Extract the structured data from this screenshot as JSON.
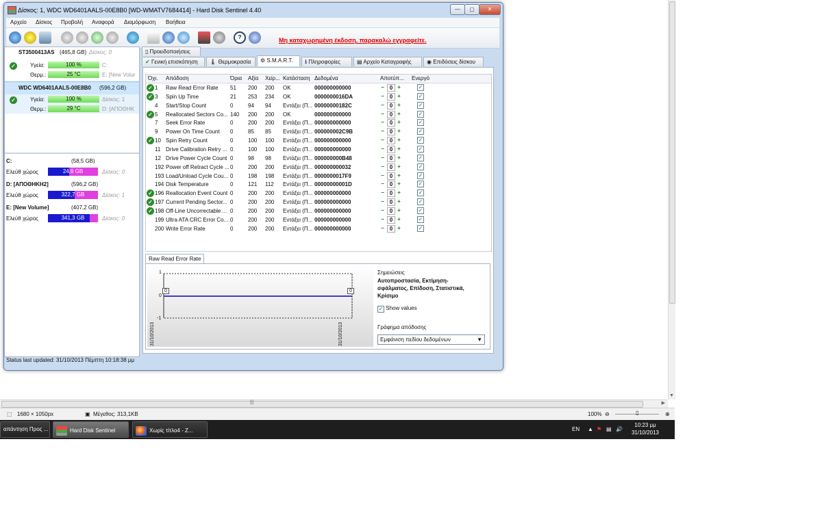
{
  "window": {
    "title": "Δίσκος: 1, WDC WD6401AALS-00E8B0 [WD-WMATV7684414]  -  Hard Disk Sentinel 4.40",
    "controls": [
      "—",
      "▢",
      "✕"
    ]
  },
  "menu": [
    "Αρχείο",
    "Δίσκος",
    "Προβολή",
    "Αναφορά",
    "Διαμόρφωση",
    "Βοήθεια"
  ],
  "toolbar": {
    "register_text": "Μη καταχωρημένη έκδοση, παρακαλώ εγγραφείτε."
  },
  "disks": [
    {
      "name": "ST3500413AS",
      "size": "(465,8 GB)",
      "disk_label": "Δίσκος: 0",
      "health_label": "Υγεία:",
      "health_value": "100 %",
      "health_pct": 100,
      "health_extra": "C:",
      "temp_label": "Θερμ.:",
      "temp_value": "25 °C",
      "temp_extra": "E: [New Volur"
    },
    {
      "name": "WDC WD6401AALS-00E8B0",
      "size": "(596,2 GB)",
      "disk_label": "",
      "health_label": "Υγεία:",
      "health_value": "100 %",
      "health_pct": 100,
      "health_extra": "Δίσκος: 1",
      "temp_label": "Θερμ.:",
      "temp_value": "29 °C",
      "temp_extra": "D: [ΑΠΟΘΗΚ"
    }
  ],
  "volumes": [
    {
      "name": "C:",
      "size": "(58,5 GB)",
      "free_label": "Ελεύθ χώρος",
      "free": "24,6 GB",
      "free_pct": 42,
      "disk": "Δίσκος: 0"
    },
    {
      "name": "D: [ΑΠΟΘΗΚΗ2]",
      "size": "(596,2 GB)",
      "free_label": "Ελεύθ χώρος",
      "free": "322,7 GB",
      "free_pct": 54,
      "disk": "Δίσκος: 1"
    },
    {
      "name": "E: [New Volume]",
      "size": "(407,2 GB)",
      "free_label": "Ελεύθ χώρος",
      "free": "341,3 GB",
      "free_pct": 84,
      "disk": "Δίσκος: 0"
    }
  ],
  "tabs_top": [
    "Προειδοποιήσεις"
  ],
  "tabs": [
    "Γενική επισκόπηση",
    "Θερμοκρασία",
    "S.M.A.R.T.",
    "Πληροφορίες",
    "Αρχείο Καταγραφής",
    "Επιδόσεις δίσκου"
  ],
  "selected_tab": "S.M.A.R.T.",
  "smart": {
    "headers": [
      "Όχι.",
      "Απόδοση",
      "Όρια",
      "Αξία",
      "Χείρ...",
      "Κατάσταση",
      "Δεδομένα",
      "Αποτύπ...",
      "Ενεργό"
    ],
    "rows": [
      {
        "ok": true,
        "id": "1",
        "name": "Raw Read Error Rate",
        "thr": "51",
        "val": "200",
        "worst": "200",
        "status": "OK",
        "data": "000000000000",
        "offset": "0"
      },
      {
        "ok": true,
        "id": "3",
        "name": "Spin Up Time",
        "thr": "21",
        "val": "253",
        "worst": "234",
        "status": "OK",
        "data": "0000000016DA",
        "offset": "0"
      },
      {
        "ok": false,
        "id": "4",
        "name": "Start/Stop Count",
        "thr": "0",
        "val": "94",
        "worst": "94",
        "status": "Εντάξει (Π...",
        "data": "00000000182C",
        "offset": "0"
      },
      {
        "ok": true,
        "id": "5",
        "name": "Reallocated Sectors Co...",
        "thr": "140",
        "val": "200",
        "worst": "200",
        "status": "OK",
        "data": "000000000000",
        "offset": "0"
      },
      {
        "ok": false,
        "id": "7",
        "name": "Seek Error Rate",
        "thr": "0",
        "val": "200",
        "worst": "200",
        "status": "Εντάξει (Π...",
        "data": "000000000000",
        "offset": "0"
      },
      {
        "ok": false,
        "id": "9",
        "name": "Power On Time Count",
        "thr": "0",
        "val": "85",
        "worst": "85",
        "status": "Εντάξει (Π...",
        "data": "000000002C9B",
        "offset": "0"
      },
      {
        "ok": true,
        "id": "10",
        "name": "Spin Retry Count",
        "thr": "0",
        "val": "100",
        "worst": "100",
        "status": "Εντάξει (Π...",
        "data": "000000000000",
        "offset": "0"
      },
      {
        "ok": false,
        "id": "11",
        "name": "Drive Calibration Retry ...",
        "thr": "0",
        "val": "100",
        "worst": "100",
        "status": "Εντάξει (Π...",
        "data": "000000000000",
        "offset": "0"
      },
      {
        "ok": false,
        "id": "12",
        "name": "Drive Power Cycle Count",
        "thr": "0",
        "val": "98",
        "worst": "98",
        "status": "Εντάξει (Π...",
        "data": "000000000B48",
        "offset": "0"
      },
      {
        "ok": false,
        "id": "192",
        "name": "Power off Retract Cycle ...",
        "thr": "0",
        "val": "200",
        "worst": "200",
        "status": "Εντάξει (Π...",
        "data": "000000000032",
        "offset": "0"
      },
      {
        "ok": false,
        "id": "193",
        "name": "Load/Unload Cycle Cou...",
        "thr": "0",
        "val": "198",
        "worst": "198",
        "status": "Εντάξει (Π...",
        "data": "0000000017F9",
        "offset": "0"
      },
      {
        "ok": false,
        "id": "194",
        "name": "Disk Temperature",
        "thr": "0",
        "val": "121",
        "worst": "112",
        "status": "Εντάξει (Π...",
        "data": "00000000001D",
        "offset": "0"
      },
      {
        "ok": true,
        "id": "196",
        "name": "Reallocation Event Count",
        "thr": "0",
        "val": "200",
        "worst": "200",
        "status": "Εντάξει (Π...",
        "data": "000000000000",
        "offset": "0"
      },
      {
        "ok": true,
        "id": "197",
        "name": "Current Pending Sector...",
        "thr": "0",
        "val": "200",
        "worst": "200",
        "status": "Εντάξει (Π...",
        "data": "000000000000",
        "offset": "0"
      },
      {
        "ok": true,
        "id": "198",
        "name": "Off-Line Uncorrectable ...",
        "thr": "0",
        "val": "200",
        "worst": "200",
        "status": "Εντάξει (Π...",
        "data": "000000000000",
        "offset": "0"
      },
      {
        "ok": false,
        "id": "199",
        "name": "Ultra ATA CRC Error Co...",
        "thr": "0",
        "val": "200",
        "worst": "200",
        "status": "Εντάξει (Π...",
        "data": "000000000000",
        "offset": "0"
      },
      {
        "ok": false,
        "id": "200",
        "name": "Write Error Rate",
        "thr": "0",
        "val": "200",
        "worst": "200",
        "status": "Εντάξει (Π...",
        "data": "000000000000",
        "offset": "0"
      }
    ]
  },
  "graph": {
    "tab": "Raw Read Error Rate",
    "y_ticks": [
      "1",
      "0",
      "-1"
    ],
    "x_ticks": [
      "31/10/2013",
      "31/10/2013"
    ],
    "point_labels": [
      "0",
      "0"
    ],
    "notes_label": "Σημειώσεις",
    "notes_bold": "Αυτοπροστασία, Εκτίμηση-σφάλματος, Επίδοση, Στατιστικά, Κρίσιμο",
    "show_values_label": "Show values",
    "show_values_checked": true,
    "perf_label": "Γράφημα απόδοσης",
    "perf_select": "Εμφάνιση πεδίου δεδομένων"
  },
  "status_bar": "Status last updated: 31/10/2013 Πέμπτη 10:18:38 μμ",
  "paint_status": {
    "dims": "1680 × 1050px",
    "size": "Μέγεθος: 313,1KB",
    "zoom": "100%"
  },
  "taskbar": {
    "items": [
      "απάντηση Προς ...",
      "Hard Disk Sentinel",
      "Χωρίς τίτλο4 - Z..."
    ],
    "lang": "EN",
    "time": "10:23 μμ",
    "date": "31/10/2013"
  }
}
